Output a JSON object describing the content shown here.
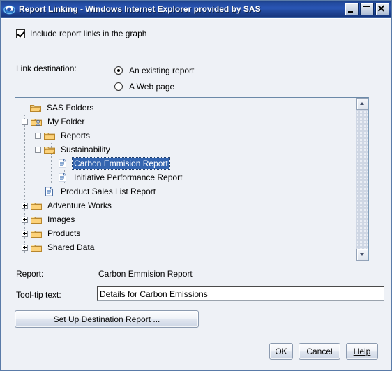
{
  "window": {
    "title": "Report Linking - Windows Internet Explorer provided by SAS",
    "logo_icon": "internet-explorer-icon",
    "controls": {
      "minimize": "minimize-icon",
      "maximize": "maximize-icon",
      "close": "close-icon"
    }
  },
  "options": {
    "include_links_label": "Include report links in the graph",
    "include_links_checked": true,
    "link_destination_label": "Link destination:",
    "radios": [
      {
        "label": "An existing report",
        "selected": true
      },
      {
        "label": "A Web page",
        "selected": false
      }
    ]
  },
  "tree": {
    "nodes": [
      {
        "label": "SAS Folders",
        "icon": "open-folder-icon",
        "expander": "none",
        "depth": 0,
        "selected": false
      },
      {
        "label": "My Folder",
        "icon": "user-folder-icon",
        "expander": "minus",
        "depth": 1,
        "selected": false
      },
      {
        "label": "Reports",
        "icon": "folder-icon",
        "expander": "plus",
        "depth": 2,
        "selected": false
      },
      {
        "label": "Sustainability",
        "icon": "open-folder-icon",
        "expander": "minus",
        "depth": 2,
        "selected": false
      },
      {
        "label": "Carbon Emmision Report",
        "icon": "report-document-icon",
        "expander": "none",
        "depth": 3,
        "selected": true
      },
      {
        "label": "Initiative Performance Report",
        "icon": "report-document-icon",
        "expander": "none",
        "depth": 3,
        "selected": false
      },
      {
        "label": "Product Sales List Report",
        "icon": "report-document-icon",
        "expander": "none",
        "depth": 2,
        "selected": false
      },
      {
        "label": "Adventure Works",
        "icon": "folder-icon",
        "expander": "plus",
        "depth": 1,
        "selected": false
      },
      {
        "label": "Images",
        "icon": "folder-icon",
        "expander": "plus",
        "depth": 1,
        "selected": false
      },
      {
        "label": "Products",
        "icon": "folder-icon",
        "expander": "plus",
        "depth": 1,
        "selected": false
      },
      {
        "label": "Shared Data",
        "icon": "folder-icon",
        "expander": "plus",
        "depth": 1,
        "selected": false
      }
    ],
    "scrollbar": {
      "up_icon": "scroll-up-arrow-icon",
      "down_icon": "scroll-down-arrow-icon"
    }
  },
  "fields": {
    "report_label": "Report:",
    "report_value": "Carbon Emmision Report",
    "tooltip_label": "Tool-tip text:",
    "tooltip_value": "Details for Carbon Emissions",
    "tooltip_placeholder": ""
  },
  "buttons": {
    "setup": "Set Up Destination Report ...",
    "ok": "OK",
    "cancel": "Cancel",
    "help": "Help"
  },
  "colors": {
    "titlebar": "#21489b",
    "selection": "#3465b0",
    "dialog_bg": "#eef1f6",
    "panel_border": "#7f9db9",
    "folder": "#e8b552"
  }
}
